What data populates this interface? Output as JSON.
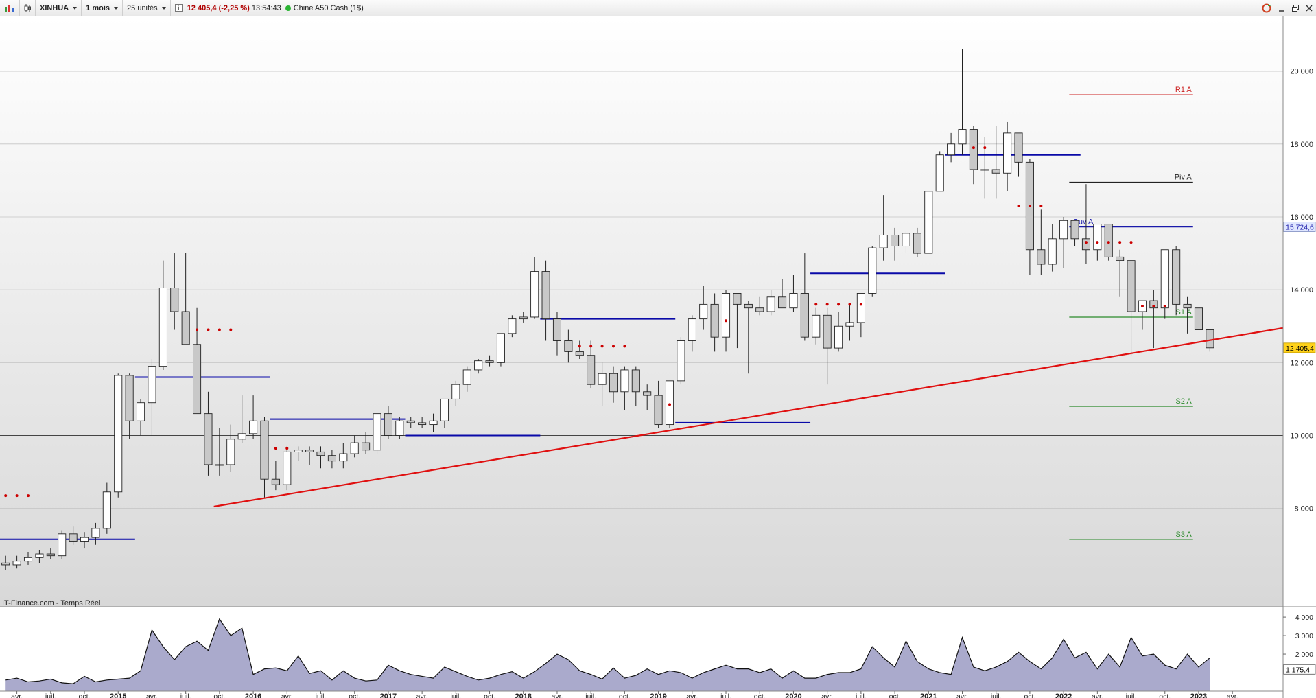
{
  "toolbar": {
    "symbol": "XINHUA",
    "period": "1 mois",
    "units": "25 unités",
    "price": "12 405,4",
    "change": "(-2,25 %)",
    "time": "13:54:43",
    "instrument": "Chine A50 Cash (1$)"
  },
  "icons": [
    "chart-icon",
    "candles-icon",
    "info-icon",
    "refresh-icon",
    "minimize-icon",
    "restore-icon",
    "close-icon"
  ],
  "source_label": "IT-Finance.com - Temps Réel",
  "chart_data": {
    "type": "candlestick",
    "x_ticks": [
      {
        "m": 1,
        "label": "avr."
      },
      {
        "m": 4,
        "label": "juil."
      },
      {
        "m": 7,
        "label": "oct."
      },
      {
        "m": 10,
        "label": "2015"
      },
      {
        "m": 13,
        "label": "avr."
      },
      {
        "m": 16,
        "label": "juil."
      },
      {
        "m": 19,
        "label": "oct."
      },
      {
        "m": 22,
        "label": "2016"
      },
      {
        "m": 25,
        "label": "avr."
      },
      {
        "m": 28,
        "label": "juil."
      },
      {
        "m": 31,
        "label": "oct."
      },
      {
        "m": 34,
        "label": "2017"
      },
      {
        "m": 37,
        "label": "avr."
      },
      {
        "m": 40,
        "label": "juil."
      },
      {
        "m": 43,
        "label": "oct."
      },
      {
        "m": 46,
        "label": "2018"
      },
      {
        "m": 49,
        "label": "avr."
      },
      {
        "m": 52,
        "label": "juil."
      },
      {
        "m": 55,
        "label": "oct."
      },
      {
        "m": 58,
        "label": "2019"
      },
      {
        "m": 61,
        "label": "avr."
      },
      {
        "m": 64,
        "label": "juil."
      },
      {
        "m": 67,
        "label": "oct."
      },
      {
        "m": 70,
        "label": "2020"
      },
      {
        "m": 73,
        "label": "avr."
      },
      {
        "m": 76,
        "label": "juil."
      },
      {
        "m": 79,
        "label": "oct."
      },
      {
        "m": 82,
        "label": "2021"
      },
      {
        "m": 85,
        "label": "avr."
      },
      {
        "m": 88,
        "label": "juil."
      },
      {
        "m": 91,
        "label": "oct."
      },
      {
        "m": 94,
        "label": "2022"
      },
      {
        "m": 97,
        "label": "avr."
      },
      {
        "m": 100,
        "label": "juil."
      },
      {
        "m": 103,
        "label": "oct."
      },
      {
        "m": 106,
        "label": "2023"
      },
      {
        "m": 109,
        "label": "avr."
      }
    ],
    "y_ticks": [
      "8 000",
      "10 000",
      "12 000",
      "14 000",
      "16 000",
      "18 000",
      "20 000"
    ],
    "ylim": [
      5300,
      21500
    ],
    "xlim": [
      -0.5,
      113.5
    ],
    "grid": true,
    "candles": [
      [
        6500,
        6700,
        6300,
        6450
      ],
      [
        6450,
        6700,
        6350,
        6550
      ],
      [
        6550,
        6800,
        6450,
        6650
      ],
      [
        6650,
        6850,
        6500,
        6750
      ],
      [
        6750,
        6900,
        6600,
        6700
      ],
      [
        6700,
        7400,
        6600,
        7300
      ],
      [
        7300,
        7500,
        7000,
        7100
      ],
      [
        7100,
        7350,
        6900,
        7200
      ],
      [
        7200,
        7600,
        7000,
        7450
      ],
      [
        7450,
        8700,
        7300,
        8450
      ],
      [
        8450,
        11700,
        8300,
        11650
      ],
      [
        11650,
        11700,
        9900,
        10400
      ],
      [
        10400,
        11000,
        10000,
        10900
      ],
      [
        10900,
        12100,
        10000,
        11900
      ],
      [
        11900,
        14800,
        11800,
        14050
      ],
      [
        14050,
        15000,
        12900,
        13400
      ],
      [
        13400,
        15000,
        12500,
        12500
      ],
      [
        12500,
        13500,
        10800,
        10600
      ],
      [
        10600,
        11200,
        8900,
        9200
      ],
      [
        9200,
        10200,
        8900,
        9200
      ],
      [
        9200,
        10300,
        9000,
        9900
      ],
      [
        9900,
        11100,
        9800,
        10050
      ],
      [
        10050,
        11100,
        9900,
        10400
      ],
      [
        10400,
        10500,
        8300,
        8800
      ],
      [
        8800,
        9300,
        8500,
        8650
      ],
      [
        8650,
        9700,
        8500,
        9550
      ],
      [
        9550,
        9700,
        9300,
        9600
      ],
      [
        9600,
        9700,
        9200,
        9550
      ],
      [
        9550,
        9700,
        9100,
        9450
      ],
      [
        9450,
        9600,
        9100,
        9300
      ],
      [
        9300,
        9800,
        9100,
        9500
      ],
      [
        9500,
        10000,
        9400,
        9800
      ],
      [
        9800,
        10100,
        9500,
        9600
      ],
      [
        9600,
        10600,
        9500,
        10600
      ],
      [
        10600,
        10800,
        9900,
        10000
      ],
      [
        10000,
        10500,
        9900,
        10400
      ],
      [
        10400,
        10500,
        10200,
        10350
      ],
      [
        10350,
        10500,
        10200,
        10300
      ],
      [
        10300,
        10600,
        10100,
        10400
      ],
      [
        10400,
        11000,
        10200,
        11000
      ],
      [
        11000,
        11500,
        10800,
        11400
      ],
      [
        11400,
        11900,
        11200,
        11800
      ],
      [
        11800,
        12100,
        11700,
        12050
      ],
      [
        12050,
        12200,
        11900,
        12000
      ],
      [
        12000,
        12800,
        11900,
        12800
      ],
      [
        12800,
        13300,
        12700,
        13200
      ],
      [
        13200,
        13400,
        13100,
        13250
      ],
      [
        13250,
        14900,
        13200,
        14500
      ],
      [
        14500,
        14800,
        12600,
        13200
      ],
      [
        13200,
        13400,
        12200,
        12600
      ],
      [
        12600,
        12900,
        12000,
        12300
      ],
      [
        12300,
        12600,
        12100,
        12200
      ],
      [
        12200,
        12600,
        11300,
        11400
      ],
      [
        11400,
        12000,
        10800,
        11700
      ],
      [
        11700,
        11900,
        10900,
        11200
      ],
      [
        11200,
        11900,
        10700,
        11800
      ],
      [
        11800,
        11900,
        10800,
        11200
      ],
      [
        11200,
        11400,
        10700,
        11100
      ],
      [
        11100,
        11500,
        10200,
        10300
      ],
      [
        10300,
        11500,
        10200,
        11500
      ],
      [
        11500,
        12700,
        11400,
        12600
      ],
      [
        12600,
        13300,
        12300,
        13200
      ],
      [
        13200,
        14100,
        12900,
        13600
      ],
      [
        13600,
        13900,
        12300,
        12700
      ],
      [
        12700,
        14000,
        12300,
        13900
      ],
      [
        13900,
        13900,
        12400,
        13600
      ],
      [
        13600,
        13700,
        11700,
        13500
      ],
      [
        13500,
        13800,
        13300,
        13400
      ],
      [
        13400,
        14000,
        13300,
        13800
      ],
      [
        13800,
        14300,
        13500,
        13500
      ],
      [
        13500,
        14400,
        13400,
        13900
      ],
      [
        13900,
        15000,
        12600,
        12700
      ],
      [
        12700,
        13500,
        12500,
        13300
      ],
      [
        13300,
        13500,
        11400,
        12400
      ],
      [
        12400,
        13400,
        12300,
        13000
      ],
      [
        13000,
        13600,
        12600,
        13100
      ],
      [
        13100,
        13900,
        12700,
        13900
      ],
      [
        13900,
        15200,
        13800,
        15150
      ],
      [
        15150,
        16600,
        14800,
        15500
      ],
      [
        15500,
        15700,
        14800,
        15200
      ],
      [
        15200,
        15600,
        15000,
        15550
      ],
      [
        15550,
        15700,
        14900,
        15000
      ],
      [
        15000,
        16300,
        15000,
        16700
      ],
      [
        16700,
        17800,
        16700,
        17700
      ],
      [
        17700,
        18300,
        17500,
        18000
      ],
      [
        18000,
        20600,
        17700,
        18400
      ],
      [
        18400,
        18500,
        16900,
        17300
      ],
      [
        17300,
        18200,
        16500,
        17300
      ],
      [
        17300,
        18500,
        16500,
        17200
      ],
      [
        17200,
        18600,
        16700,
        18300
      ],
      [
        18300,
        18300,
        17100,
        17500
      ],
      [
        17500,
        17600,
        14400,
        15100
      ],
      [
        15100,
        16200,
        14400,
        14700
      ],
      [
        14700,
        15800,
        14500,
        15400
      ],
      [
        15400,
        16000,
        14600,
        15900
      ],
      [
        15900,
        15900,
        15200,
        15400
      ],
      [
        15400,
        16900,
        14700,
        15100
      ],
      [
        15100,
        15800,
        14800,
        15800
      ],
      [
        15800,
        15800,
        14800,
        14900
      ],
      [
        14900,
        15100,
        13800,
        14800
      ],
      [
        14800,
        14800,
        12200,
        13400
      ],
      [
        13400,
        13500,
        12900,
        13700
      ],
      [
        13700,
        14000,
        12400,
        13500
      ],
      [
        13500,
        15100,
        13200,
        15100
      ],
      [
        15100,
        15200,
        13300,
        13600
      ],
      [
        13600,
        13800,
        12800,
        13500
      ],
      [
        13500,
        13500,
        12900,
        12900
      ],
      [
        12900,
        12900,
        12300,
        12405.4
      ]
    ],
    "blue_levels": [
      {
        "from": -0.5,
        "to": 11.5,
        "value": 7150
      },
      {
        "from": 11.5,
        "to": 23.5,
        "value": 11600
      },
      {
        "from": 23.5,
        "to": 35.5,
        "value": 10450
      },
      {
        "from": 35.5,
        "to": 47.5,
        "value": 10000
      },
      {
        "from": 47.5,
        "to": 59.5,
        "value": 13200
      },
      {
        "from": 59.5,
        "to": 71.5,
        "value": 10350
      },
      {
        "from": 71.5,
        "to": 83.5,
        "value": 14450
      },
      {
        "from": 83.5,
        "to": 95.5,
        "value": 17700
      }
    ],
    "dots": [
      {
        "from": 0,
        "to": 2,
        "value": 8350
      },
      {
        "from": 17,
        "to": 20,
        "value": 12900
      },
      {
        "from": 24,
        "to": 25,
        "value": 9650
      },
      {
        "from": 51,
        "to": 55,
        "value": 12450
      },
      {
        "from": 59,
        "to": 59,
        "value": 10850
      },
      {
        "from": 64,
        "to": 64,
        "value": 13150
      },
      {
        "from": 72,
        "to": 76,
        "value": 13600
      },
      {
        "from": 86,
        "to": 87,
        "value": 17900
      },
      {
        "from": 90,
        "to": 92,
        "value": 16300
      },
      {
        "from": 96,
        "to": 100,
        "value": 15300
      },
      {
        "from": 101,
        "to": 103,
        "value": 13550
      }
    ],
    "trendline": {
      "from": [
        18.5,
        8050
      ],
      "to": [
        113.5,
        12950
      ]
    },
    "annual_levels": [
      {
        "label": "R1 A",
        "value": 19350,
        "color": "#cc2222"
      },
      {
        "label": "Piv A",
        "value": 16950,
        "color": "#222222"
      },
      {
        "label": "Ouv A",
        "value": 15724.6,
        "color": "#1a1aaa"
      },
      {
        "label": "S1 A",
        "value": 13250,
        "color": "#2a8a2a"
      },
      {
        "label": "S2 A",
        "value": 10800,
        "color": "#2a8a2a"
      },
      {
        "label": "S3 A",
        "value": 7150,
        "color": "#2a8a2a"
      }
    ],
    "annual_levels_span": [
      94.5,
      105.5
    ],
    "price_tags": [
      {
        "label": "15 724,6",
        "value": 15724.6
      },
      {
        "label": "12 405,4",
        "value": 12405.4
      }
    ],
    "volume": {
      "ylim": [
        0,
        4300
      ],
      "ticks": [
        "4 000",
        "3 000",
        "2 000"
      ],
      "last_label": "1 175,4",
      "last_value": 1175.4,
      "values": [
        600,
        700,
        500,
        550,
        650,
        450,
        400,
        800,
        500,
        600,
        650,
        700,
        1100,
        3300,
        2400,
        1700,
        2400,
        2700,
        2200,
        3900,
        3000,
        3400,
        900,
        1200,
        1250,
        1100,
        1900,
        950,
        1100,
        600,
        1100,
        700,
        550,
        600,
        1400,
        1100,
        900,
        800,
        700,
        1300,
        1050,
        800,
        600,
        700,
        900,
        1050,
        700,
        1050,
        1500,
        2000,
        1700,
        1100,
        900,
        650,
        1250,
        700,
        850,
        1200,
        900,
        1100,
        1000,
        700,
        1000,
        1200,
        1400,
        1200,
        1200,
        1000,
        1200,
        700,
        1100,
        700,
        700,
        900,
        1000,
        1000,
        1200,
        2400,
        1800,
        1300,
        2700,
        1600,
        1200,
        1000,
        900,
        2900,
        1300,
        1100,
        1300,
        1600,
        2100,
        1600,
        1200,
        1800,
        2800,
        1800,
        2100,
        1200,
        2000,
        1300,
        2900,
        1900,
        2000,
        1400,
        1200,
        2000,
        1300,
        1800
      ]
    }
  }
}
